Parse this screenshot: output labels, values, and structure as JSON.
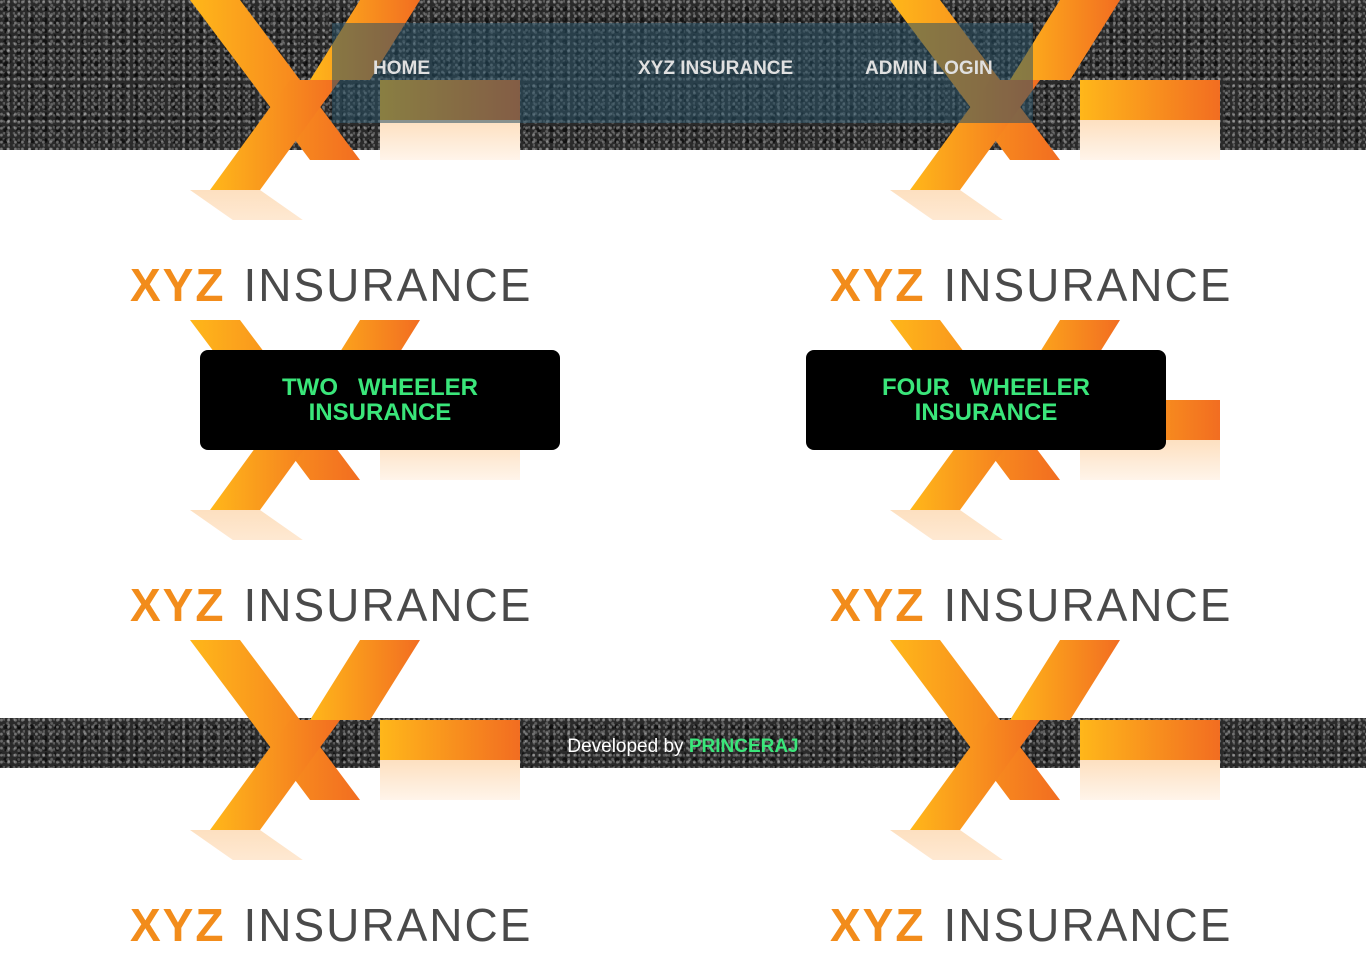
{
  "nav": {
    "home": "HOME",
    "brand": "XYZ INSURANCE",
    "admin_login": "ADMIN LOGIN"
  },
  "logo": {
    "xyz": "XYZ",
    "insurance": "INSURANCE"
  },
  "buttons": {
    "two_wheeler": "TWO   WHEELER\nINSURANCE",
    "four_wheeler": "FOUR   WHEELER\nINSURANCE"
  },
  "footer": {
    "prefix": "Developed by",
    "author": "PRINCERAJ"
  },
  "colors": {
    "logo_orange": "#f28c1b",
    "logo_gray": "#4a4a4a",
    "button_text": "#3ae67a",
    "button_bg": "#000000",
    "nav_overlay": "#285064"
  }
}
